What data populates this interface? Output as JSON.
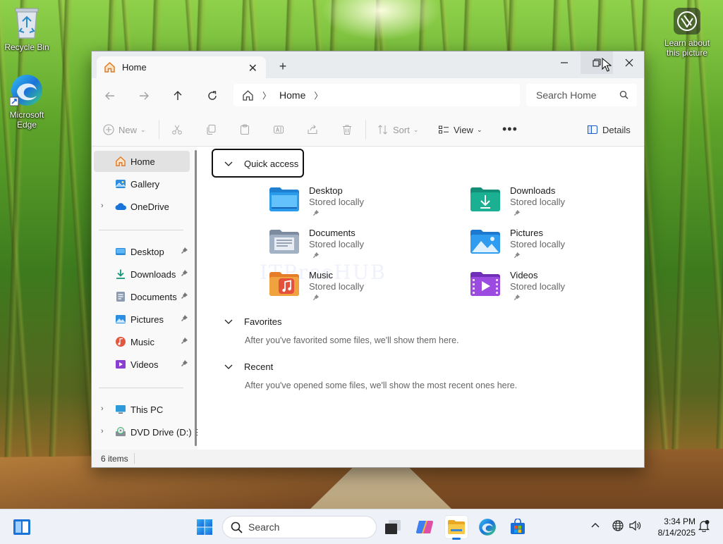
{
  "desktop": {
    "icons": [
      {
        "label": "Recycle Bin"
      },
      {
        "label": "Microsoft Edge"
      },
      {
        "label": "Learn about this picture"
      }
    ]
  },
  "window": {
    "tab": {
      "title": "Home"
    },
    "nav": {
      "breadcrumb": [
        "Home"
      ],
      "search_placeholder": "Search Home"
    },
    "toolbar": {
      "new_label": "New",
      "sort_label": "Sort",
      "view_label": "View",
      "details_label": "Details"
    },
    "sidebar": {
      "items": [
        {
          "label": "Home",
          "icon": "home-icon",
          "selected": true
        },
        {
          "label": "Gallery",
          "icon": "gallery-icon"
        },
        {
          "label": "OneDrive",
          "icon": "cloud-icon"
        },
        {
          "label": "Desktop",
          "icon": "desktop-folder-icon",
          "pinned": true
        },
        {
          "label": "Downloads",
          "icon": "downloads-folder-icon",
          "pinned": true
        },
        {
          "label": "Documents",
          "icon": "documents-folder-icon",
          "pinned": true
        },
        {
          "label": "Pictures",
          "icon": "pictures-folder-icon",
          "pinned": true
        },
        {
          "label": "Music",
          "icon": "music-folder-icon",
          "pinned": true
        },
        {
          "label": "Videos",
          "icon": "videos-folder-icon",
          "pinned": true
        },
        {
          "label": "This PC",
          "icon": "pc-icon"
        },
        {
          "label": "DVD Drive (D:) E",
          "icon": "dvd-icon"
        }
      ]
    },
    "content": {
      "quick_access": {
        "title": "Quick access",
        "tiles": [
          {
            "name": "Desktop",
            "status": "Stored locally"
          },
          {
            "name": "Downloads",
            "status": "Stored locally"
          },
          {
            "name": "Documents",
            "status": "Stored locally"
          },
          {
            "name": "Pictures",
            "status": "Stored locally"
          },
          {
            "name": "Music",
            "status": "Stored locally"
          },
          {
            "name": "Videos",
            "status": "Stored locally"
          }
        ]
      },
      "favorites": {
        "title": "Favorites",
        "empty": "After you've favorited some files, we'll show them here."
      },
      "recent": {
        "title": "Recent",
        "empty": "After you've opened some files, we'll show the most recent ones here."
      },
      "watermark": "ITProsHUB"
    },
    "status": {
      "item_count": "6 items"
    }
  },
  "taskbar": {
    "search_placeholder": "Search",
    "clock_time": "3:34 PM",
    "clock_date": "8/14/2025"
  },
  "colors": {
    "accent": "#1a73d9",
    "folder_blue": "#2a8ad8",
    "folder_green": "#1aa58a"
  }
}
